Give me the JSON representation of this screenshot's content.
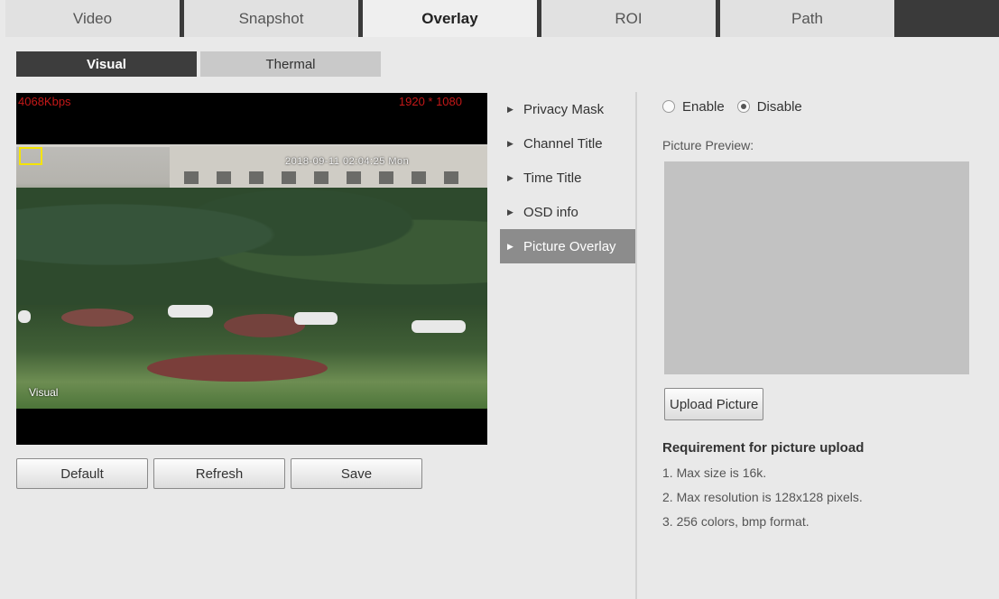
{
  "top_tabs": [
    {
      "label": "Video",
      "active": false
    },
    {
      "label": "Snapshot",
      "active": false
    },
    {
      "label": "Overlay",
      "active": true
    },
    {
      "label": "ROI",
      "active": false
    },
    {
      "label": "Path",
      "active": false
    }
  ],
  "sub_tabs": [
    {
      "label": "Visual",
      "active": true
    },
    {
      "label": "Thermal",
      "active": false
    }
  ],
  "video": {
    "bitrate": "4068Kbps",
    "resolution": "1920 * 1080",
    "osd_time": "2018-09-11 02:04:25 Mon",
    "channel_label": "Visual"
  },
  "buttons": {
    "default": "Default",
    "refresh": "Refresh",
    "save": "Save"
  },
  "menu": [
    {
      "label": "Privacy Mask",
      "active": false
    },
    {
      "label": "Channel Title",
      "active": false
    },
    {
      "label": "Time Title",
      "active": false
    },
    {
      "label": "OSD info",
      "active": false
    },
    {
      "label": "Picture Overlay",
      "active": true
    }
  ],
  "panel": {
    "enable_label": "Enable",
    "disable_label": "Disable",
    "selected": "Disable",
    "preview_label": "Picture Preview:",
    "upload_label": "Upload Picture",
    "requirement_title": "Requirement for picture upload",
    "requirements": [
      "1. Max size is 16k.",
      "2. Max resolution is 128x128 pixels.",
      "3. 256 colors, bmp format."
    ]
  },
  "colors": {
    "tab_divider": "#3a3a3a",
    "active_menu": "#8c8c8c",
    "osd_text": "#c41818",
    "overlay_box": "#f5e400"
  }
}
